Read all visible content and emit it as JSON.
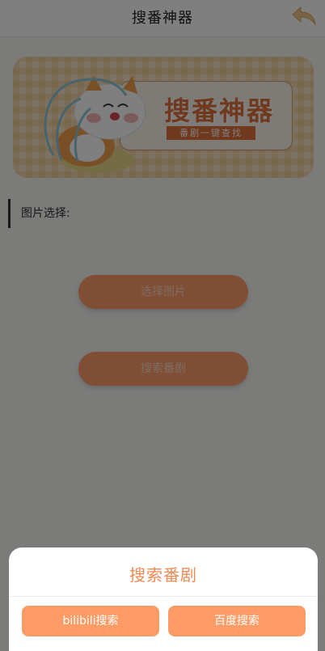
{
  "header": {
    "title": "搜番神器",
    "back_icon": "back-arrow-icon"
  },
  "banner": {
    "title": "搜番神器",
    "subtitle": "番剧一键查找",
    "mascot": "fox-mascot-illustration"
  },
  "section": {
    "label": "图片选择:"
  },
  "buttons": {
    "select_image": "选择图片",
    "search_anime": "搜索番剧"
  },
  "sheet": {
    "title": "搜索番剧",
    "bilibili_label": "bilibili搜索",
    "baidu_label": "百度搜索"
  },
  "colors": {
    "accent": "#ff9c66",
    "accent_text": "#f08a55",
    "banner_title": "#e0703a"
  }
}
